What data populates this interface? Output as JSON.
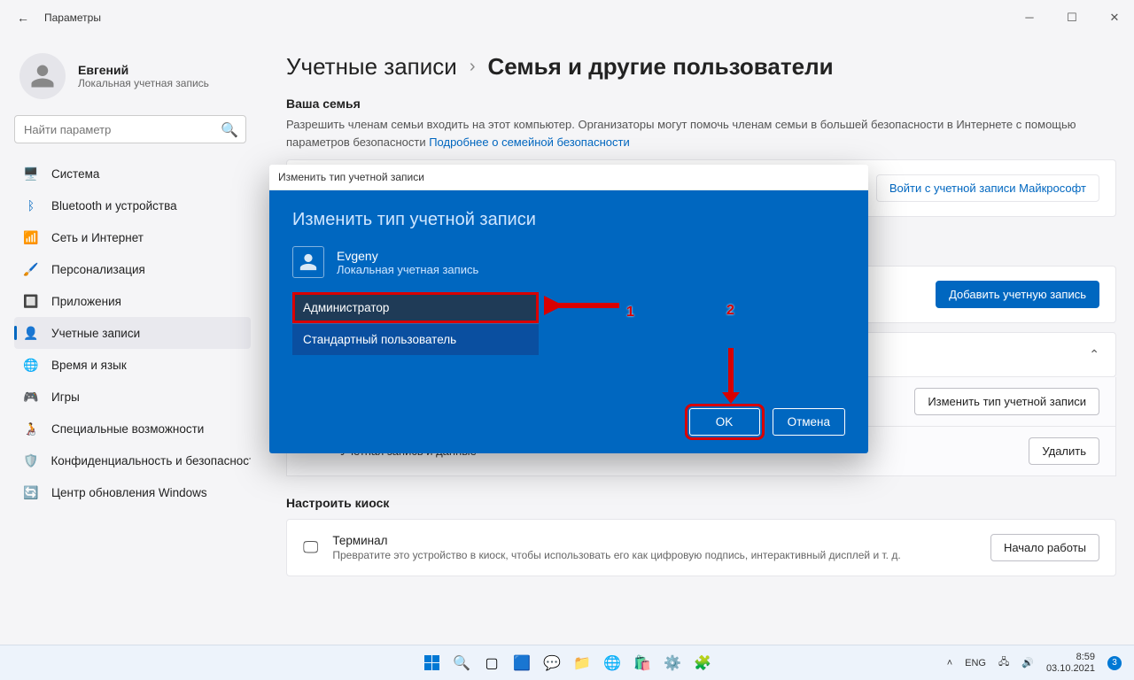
{
  "window": {
    "title": "Параметры"
  },
  "user": {
    "name": "Евгений",
    "subtitle": "Локальная учетная запись"
  },
  "search": {
    "placeholder": "Найти параметр"
  },
  "nav": {
    "system": "Система",
    "bluetooth": "Bluetooth и устройства",
    "network": "Сеть и Интернет",
    "personalization": "Персонализация",
    "apps": "Приложения",
    "accounts": "Учетные записи",
    "time": "Время и язык",
    "gaming": "Игры",
    "accessibility": "Специальные возможности",
    "privacy": "Конфиденциальность и безопасность",
    "update": "Центр обновления Windows"
  },
  "breadcrumb": {
    "root": "Учетные записи",
    "sep": "›",
    "current": "Семья и другие пользователи"
  },
  "family": {
    "heading": "Ваша семья",
    "text": "Разрешить членам семьи входить на этот компьютер. Организаторы могут помочь членам семьи в большей безопасности в Интернете с помощью параметров безопасности  ",
    "link": "Подробнее о семейной безопасности",
    "signin": "Войти с учетной записи Майкрософт"
  },
  "other": {
    "add_btn": "Добавить учетную запись"
  },
  "user_row": {
    "change_btn": "Изменить тип учетной записи",
    "data_label": "Учетная запись и данные",
    "delete_btn": "Удалить"
  },
  "kiosk": {
    "heading": "Настроить киоск",
    "title": "Терминал",
    "sub": "Превратите это устройство в киоск, чтобы использовать его как цифровую подпись, интерактивный дисплей и т. д.",
    "btn": "Начало работы"
  },
  "modal": {
    "bar_title": "Изменить тип учетной записи",
    "heading": "Изменить тип учетной записи",
    "user_name": "Evgeny",
    "user_type": "Локальная учетная запись",
    "opt_admin": "Администратор",
    "opt_standard": "Стандартный пользователь",
    "ok": "OK",
    "cancel": "Отмена"
  },
  "annotations": {
    "label1": "1",
    "label2": "2"
  },
  "tray": {
    "lang": "ENG",
    "time": "8:59",
    "date": "03.10.2021",
    "notif": "3"
  }
}
